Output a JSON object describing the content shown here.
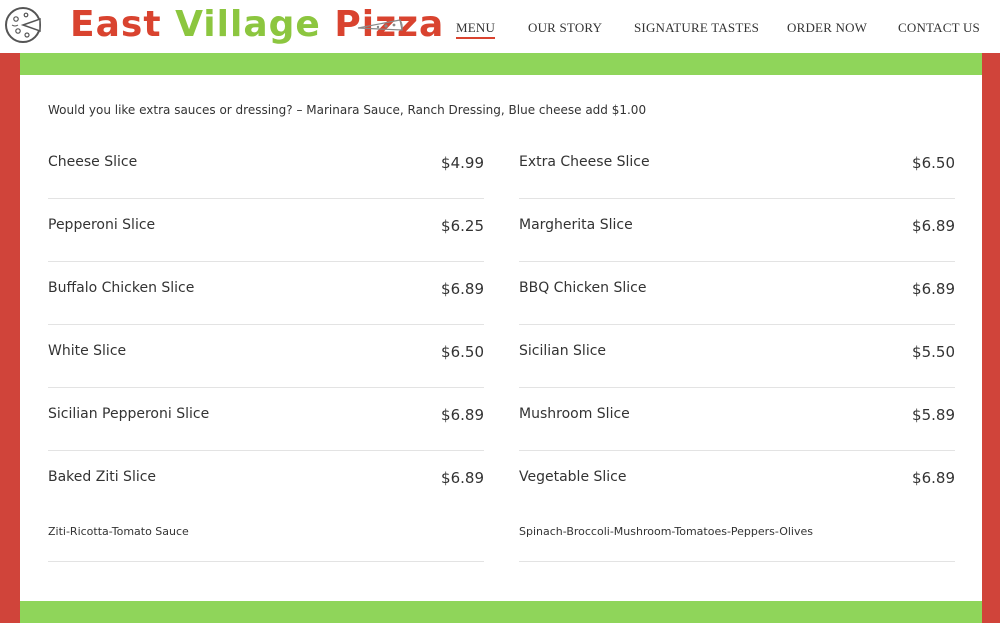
{
  "brand": {
    "word1": "East",
    "word2": "Village",
    "word3": "Pizza"
  },
  "nav": {
    "items": [
      {
        "label": "MENU",
        "active": true
      },
      {
        "label": "OUR STORY",
        "active": false
      },
      {
        "label": "SIGNATURE TASTES",
        "active": false
      },
      {
        "label": "ORDER NOW",
        "active": false
      },
      {
        "label": "CONTACT US",
        "active": false
      }
    ]
  },
  "colors": {
    "frame_red": "#d0443a",
    "band_green": "#8fd55a",
    "logo_red": "#d9432f",
    "logo_green": "#8cc63f"
  },
  "menu": {
    "note": "Would you like extra sauces or dressing? – Marinara Sauce, Ranch Dressing, Blue cheese add $1.00",
    "left": [
      {
        "name": "Cheese Slice",
        "price": "$4.99"
      },
      {
        "name": "Pepperoni Slice",
        "price": "$6.25"
      },
      {
        "name": "Buffalo Chicken Slice",
        "price": "$6.89"
      },
      {
        "name": "White Slice",
        "price": "$6.50"
      },
      {
        "name": "Sicilian Pepperoni Slice",
        "price": "$6.89"
      },
      {
        "name": "Baked Ziti Slice",
        "price": "$6.89",
        "desc": "Ziti-Ricotta-Tomato Sauce"
      }
    ],
    "right": [
      {
        "name": "Extra Cheese Slice",
        "price": "$6.50"
      },
      {
        "name": "Margherita Slice",
        "price": "$6.89"
      },
      {
        "name": "BBQ Chicken Slice",
        "price": "$6.89"
      },
      {
        "name": "Sicilian Slice",
        "price": "$5.50"
      },
      {
        "name": "Mushroom Slice",
        "price": "$5.89"
      },
      {
        "name": "Vegetable Slice",
        "price": "$6.89",
        "desc": "Spinach-Broccoli-Mushroom-Tomatoes-Peppers-Olives"
      }
    ]
  }
}
